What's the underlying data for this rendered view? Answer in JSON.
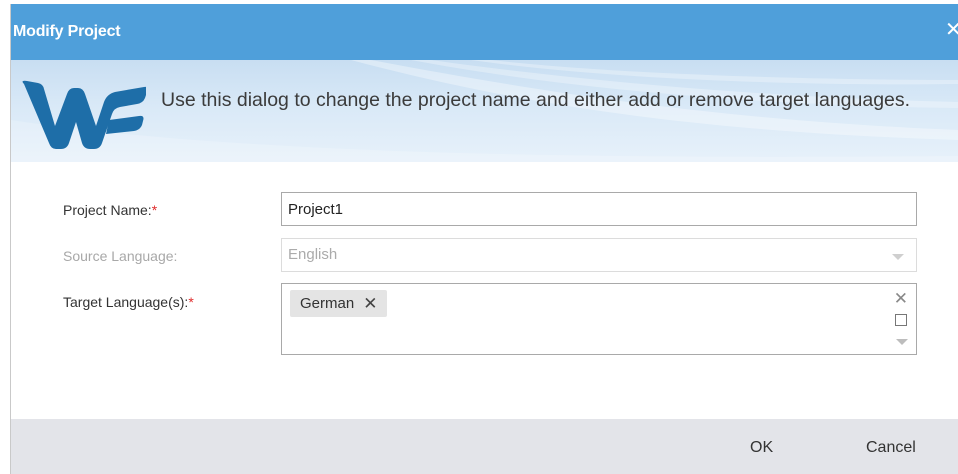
{
  "dialog": {
    "title": "Modify Project",
    "close_glyph": "✕"
  },
  "banner": {
    "logo": "wf-logo",
    "text": "Use this dialog to change the project name and either add or remove target languages."
  },
  "form": {
    "project_name": {
      "label": "Project Name:",
      "required_mark": "*",
      "value": "Project1"
    },
    "source_language": {
      "label": "Source Language:",
      "value": "English"
    },
    "target_languages": {
      "label": "Target Language(s):",
      "required_mark": "*",
      "chips": [
        {
          "label": "German",
          "remove_glyph": "✕"
        }
      ],
      "clear_glyph": "✕"
    }
  },
  "footer": {
    "ok_label": "OK",
    "cancel_label": "Cancel"
  },
  "colors": {
    "titlebar": "#4f9fda",
    "logo": "#1e6ea8",
    "required": "#e02b2b",
    "footer": "#e3e4e9"
  }
}
